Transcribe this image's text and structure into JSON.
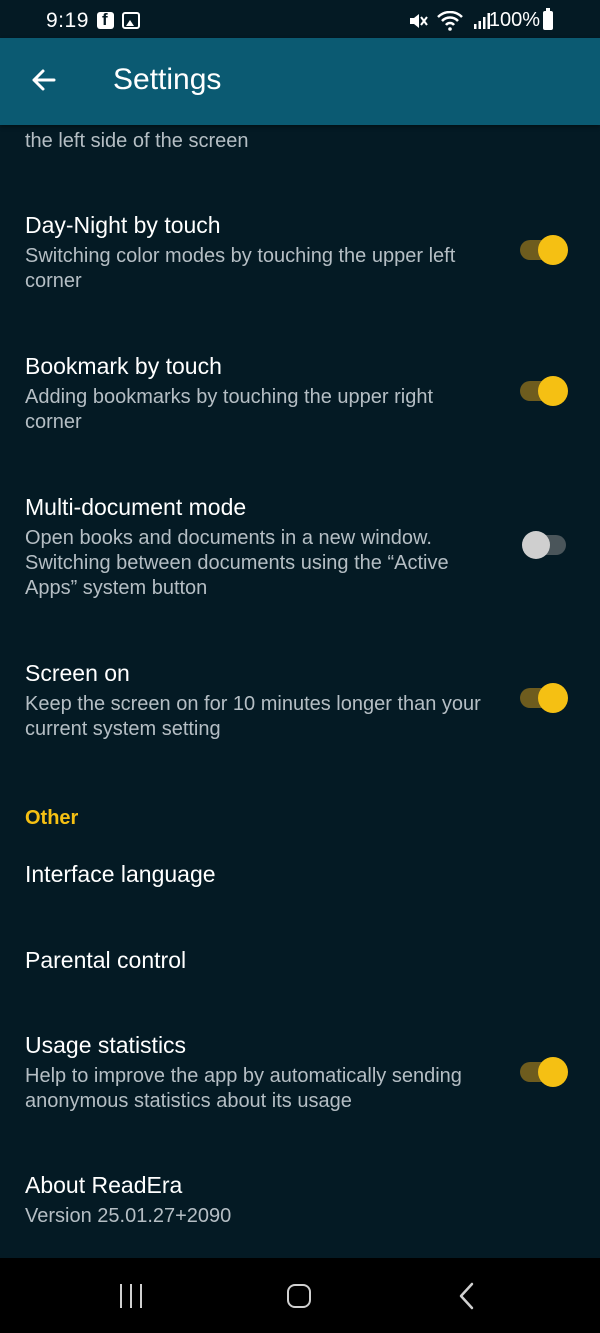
{
  "status_bar": {
    "time": "9:19",
    "battery": "100%",
    "icons": [
      "facebook-icon",
      "photo-icon",
      "mute-icon",
      "wifi-icon",
      "signal-icon",
      "battery-icon"
    ]
  },
  "app_bar": {
    "title": "Settings",
    "back_icon": "arrow-left-icon"
  },
  "settings": {
    "cutoff_item": {
      "desc_tail": "the left side of the screen"
    },
    "items": [
      {
        "title": "Day-Night by touch",
        "desc": "Switching color modes by touching the upper left corner",
        "toggle": true
      },
      {
        "title": "Bookmark by touch",
        "desc": "Adding bookmarks by touching the upper right corner",
        "toggle": true
      },
      {
        "title": "Multi-document mode",
        "desc": "Open books and documents in a new window. Switching between documents using the “Active Apps” system button",
        "toggle": false
      },
      {
        "title": "Screen on",
        "desc": "Keep the screen on for 10 minutes longer than your current system setting",
        "toggle": true
      }
    ],
    "section_other": "Other",
    "other_items": [
      {
        "title": "Interface language"
      },
      {
        "title": "Parental control"
      },
      {
        "title": "Usage statistics",
        "desc": "Help to improve the app by automatically sending anonymous statistics about its usage",
        "toggle": true
      },
      {
        "title": "About ReadEra",
        "desc": "Version 25.01.27+2090"
      }
    ]
  },
  "nav_bar": {
    "icons": [
      "recent-apps-icon",
      "home-icon",
      "back-icon"
    ]
  },
  "colors": {
    "background": "#041a24",
    "app_bar": "#0b5a72",
    "accent": "#f5c013",
    "secondary_text": "#b5bec4"
  }
}
